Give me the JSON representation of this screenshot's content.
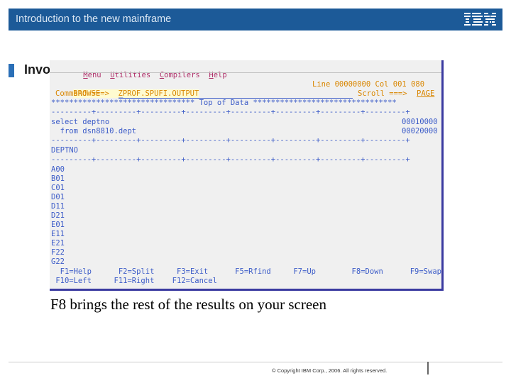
{
  "header": {
    "title": "Introduction to the new mainframe",
    "logo": "IBM"
  },
  "slide": {
    "title": "Invok"
  },
  "terminal": {
    "menu": [
      {
        "first": "M",
        "rest": "enu"
      },
      {
        "first": "U",
        "rest": "tilities"
      },
      {
        "first": "C",
        "rest": "ompilers"
      },
      {
        "first": "H",
        "rest": "elp"
      }
    ],
    "line1_left": "BROWSE    ZPROF.SPUFI.OUTPUT",
    "line1_right": "Line 00000000 Col 001 080",
    "line2_cmd": "Command ===> ",
    "line2_cursor": "_",
    "line2_scroll_label": "Scroll ===> ",
    "line2_scroll_value": "PAGE",
    "top_of_data": "******************************** Top of Data ********************************",
    "rule1": "---------+---------+---------+---------+---------+---------+---------+---------+",
    "select_line": "select deptno",
    "select_num": "00010000",
    "from_line": "  from dsn8810.dept",
    "from_num": "00020000",
    "rule2": "---------+---------+---------+---------+---------+---------+---------+---------+",
    "col_header": "DEPTNO",
    "rule3": "---------+---------+---------+---------+---------+---------+---------+---------+",
    "rows": [
      "A00",
      "B01",
      "C01",
      "D01",
      "D11",
      "D21",
      "E01",
      "E11",
      "E21",
      "F22",
      "G22"
    ],
    "pf_line1": "  F1=Help      F2=Split     F3=Exit      F5=Rfind     F7=Up        F8=Down      F9=Swap",
    "pf_line2": " F10=Left     F11=Right    F12=Cancel"
  },
  "caption": "F8 brings the rest of the results on your screen",
  "footer": {
    "copyright": "© Copyright IBM Corp., 2006. All rights reserved."
  },
  "colors": {
    "header_bg": "#1c5a98",
    "terminal_text": "#3c5cc8",
    "terminal_field": "#d98600",
    "menu_text": "#b0306a"
  }
}
